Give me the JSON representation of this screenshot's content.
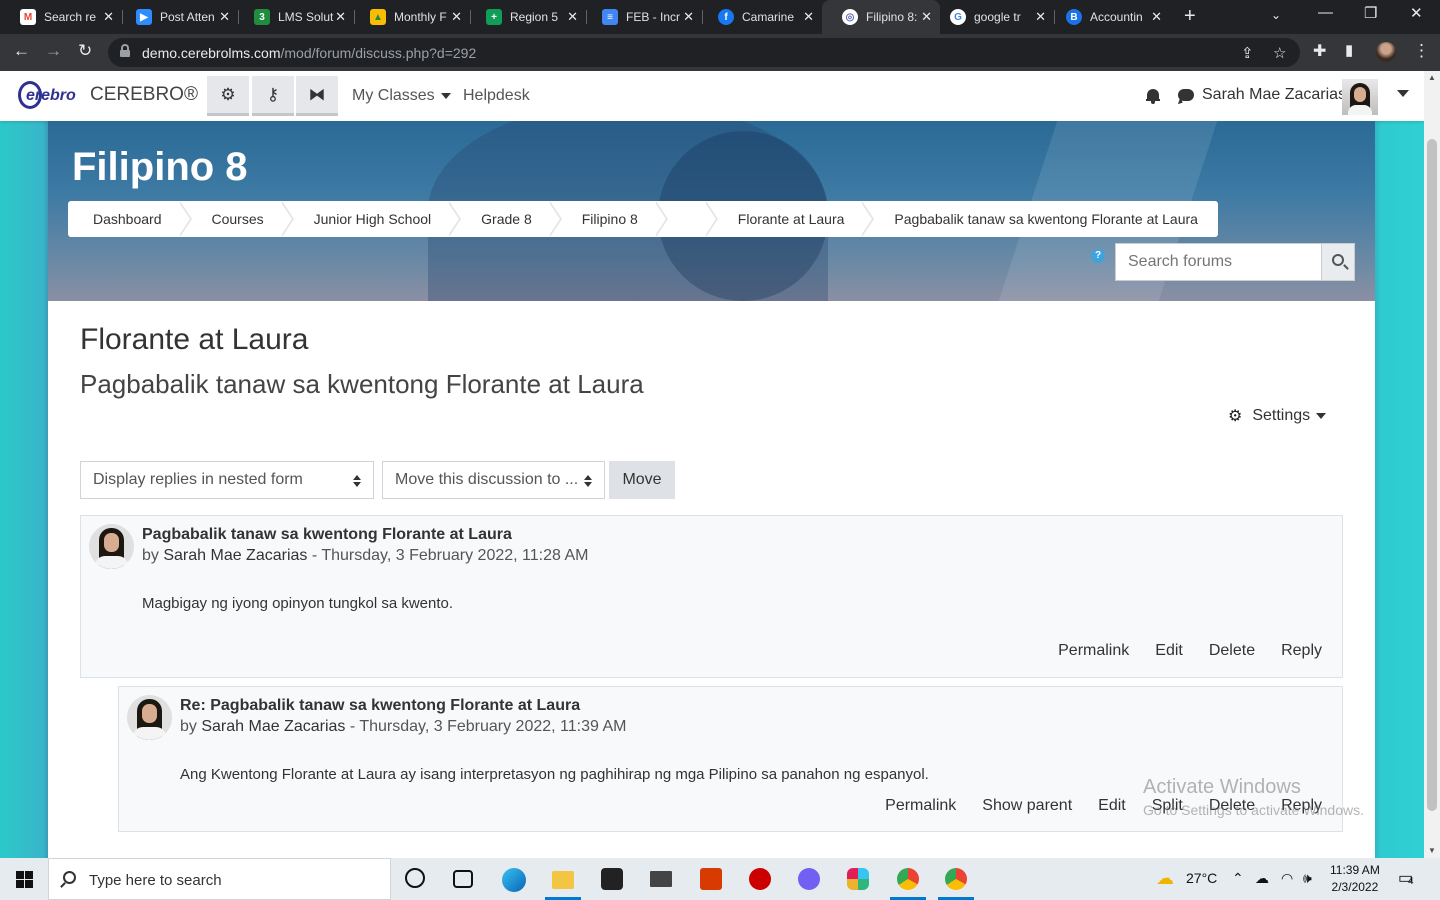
{
  "browser": {
    "tabs": [
      {
        "label": "Search re",
        "icon": "gmail-icon",
        "color": "#ea4335"
      },
      {
        "label": "Post Atten",
        "icon": "zoom-icon",
        "color": "#2d8cff"
      },
      {
        "label": "LMS Solut",
        "icon": "classroom-icon",
        "color": "#1e8e3e"
      },
      {
        "label": "Monthly F",
        "icon": "drive-icon",
        "color": "#fbbc04"
      },
      {
        "label": "Region 5",
        "icon": "sheets-icon",
        "color": "#0f9d58"
      },
      {
        "label": "FEB - Incr",
        "icon": "docs-icon",
        "color": "#4285f4"
      },
      {
        "label": "Camarine",
        "icon": "facebook-icon",
        "color": "#1877f2"
      },
      {
        "label": "Filipino 8:",
        "icon": "cerebro-icon",
        "color": "#5b6bc0"
      },
      {
        "label": "google tr",
        "icon": "google-icon",
        "color": "#ffffff"
      },
      {
        "label": "Accountin",
        "icon": "bing-icon",
        "color": "#1a73e8"
      }
    ],
    "active_tab": 7,
    "url_host": "demo.cerebrolms.com",
    "url_path": "/mod/forum/discuss.php?d=292"
  },
  "navbar": {
    "brand": "CEREBRO®",
    "logo_text": "erebro",
    "menu": [
      {
        "label": "My Classes",
        "dropdown": true
      },
      {
        "label": "Helpdesk",
        "dropdown": false
      }
    ],
    "username": "Sarah Mae Zacarias"
  },
  "header": {
    "course_title": "Filipino 8",
    "breadcrumb": [
      "Dashboard",
      "Courses",
      "Junior High School",
      "Grade 8",
      "Filipino 8",
      "",
      "Florante at Laura",
      "Pagbabalik tanaw sa kwentong Florante at Laura"
    ],
    "help": "?",
    "search_placeholder": "Search forums"
  },
  "main": {
    "forum_title": "Florante at Laura",
    "discussion_title": "Pagbabalik tanaw sa kwentong Florante at Laura",
    "settings_label": "Settings",
    "display_mode": "Display replies in nested form",
    "move_select": "Move this discussion to ...",
    "move_button": "Move"
  },
  "posts": [
    {
      "subject": "Pagbabalik tanaw sa kwentong Florante at Laura",
      "by": "by ",
      "author": "Sarah Mae Zacarias",
      "date": " - Thursday, 3 February 2022, 11:28 AM",
      "message": "Magbigay ng iyong opinyon tungkol sa kwento.",
      "actions": [
        "Permalink",
        "Edit",
        "Delete",
        "Reply"
      ]
    },
    {
      "subject": "Re: Pagbabalik tanaw sa kwentong Florante at Laura",
      "by": "by ",
      "author": "Sarah Mae Zacarias",
      "date": " - Thursday, 3 February 2022, 11:39 AM",
      "message": "Ang Kwentong Florante at Laura ay isang interpretasyon ng paghihirap ng mga Pilipino sa panahon ng espanyol.",
      "actions": [
        "Permalink",
        "Show parent",
        "Edit",
        "Split",
        "Delete",
        "Reply"
      ]
    }
  ],
  "watermark": {
    "line1": "Activate Windows",
    "line2": "Go to Settings to activate Windows."
  },
  "taskbar": {
    "search_placeholder": "Type here to search",
    "weather": "27°C",
    "time": "11:39 AM",
    "date": "2/3/2022",
    "notifications": "4"
  }
}
